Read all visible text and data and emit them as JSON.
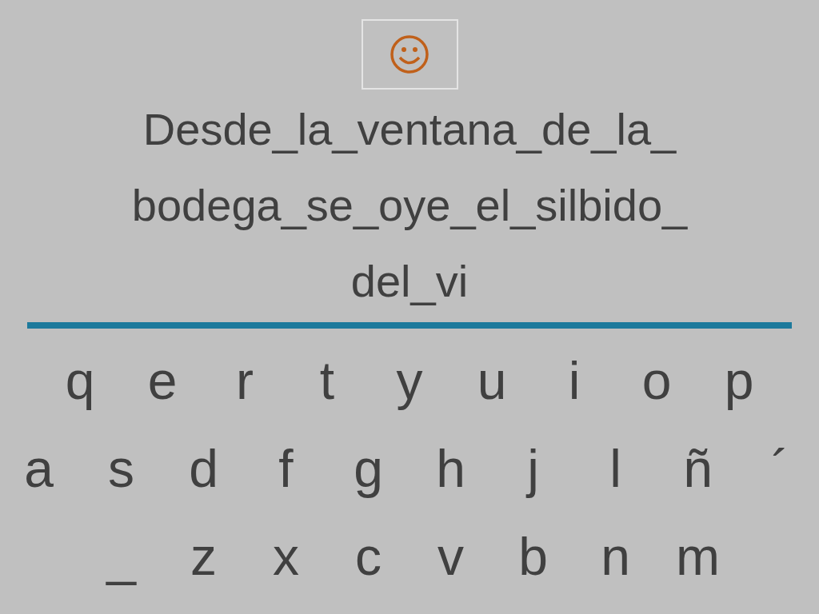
{
  "sentence_lines": [
    "Desde_la_ventana_de_la_",
    "bodega_se_oye_el_silbido_",
    "del_vi"
  ],
  "keyboard_rows": [
    [
      "q",
      "e",
      "r",
      "t",
      "y",
      "u",
      "i",
      "o",
      "p"
    ],
    [
      "a",
      "s",
      "d",
      "f",
      "g",
      "h",
      "j",
      "l",
      "ñ",
      "´"
    ],
    [
      "_",
      "z",
      "x",
      "c",
      "v",
      "b",
      "n",
      "m"
    ]
  ]
}
